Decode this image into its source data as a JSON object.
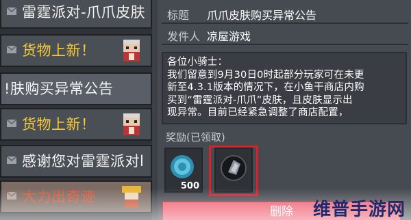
{
  "mail_list": {
    "items": [
      {
        "title": "雷霆派对-爪爪皮肤",
        "color": "#f2f2f2",
        "icon": "envelope-icon",
        "thumb": ""
      },
      {
        "title": "货物上新！",
        "color": "#f4cc3a",
        "icon": "envelope-icon",
        "thumb": "knight-character-icon"
      },
      {
        "title": "!肤购买异常公告",
        "color": "#f2f2f2",
        "icon": "",
        "thumb": ""
      },
      {
        "title": "货物上新！",
        "color": "#f4cc3a",
        "icon": "envelope-icon",
        "thumb": "knight-character-icon"
      },
      {
        "title": "感谢您对雷霆派对l",
        "color": "#f2f2f2",
        "icon": "envelope-icon",
        "thumb": ""
      },
      {
        "title": "大力出奇迹",
        "color": "#e4583a",
        "icon": "envelope-icon",
        "thumb": "character-icon"
      }
    ]
  },
  "detail": {
    "title_label": "标题",
    "title_value": "爪爪皮肤购买异常公告",
    "sender_label": "发件人",
    "sender_value": "凉屋游戏",
    "body_lines": [
      "各位小骑士：",
      "我们留意到9月30日0时起部分玩家可在未更",
      "新至4.3.1版本的情况下，在小鱼干商店内购",
      "买到“雷霆派对-爪爪”皮肤，且皮肤显示出",
      "现异常。目前已经紧急调整了商店配置，"
    ],
    "reward_label": "奖励(已领取)",
    "rewards": [
      {
        "icon": "gem-coin-icon",
        "count": "500"
      },
      {
        "icon": "claw-skin-icon",
        "count": ""
      }
    ],
    "delete_label": "删除"
  },
  "watermark": "维普手游网"
}
